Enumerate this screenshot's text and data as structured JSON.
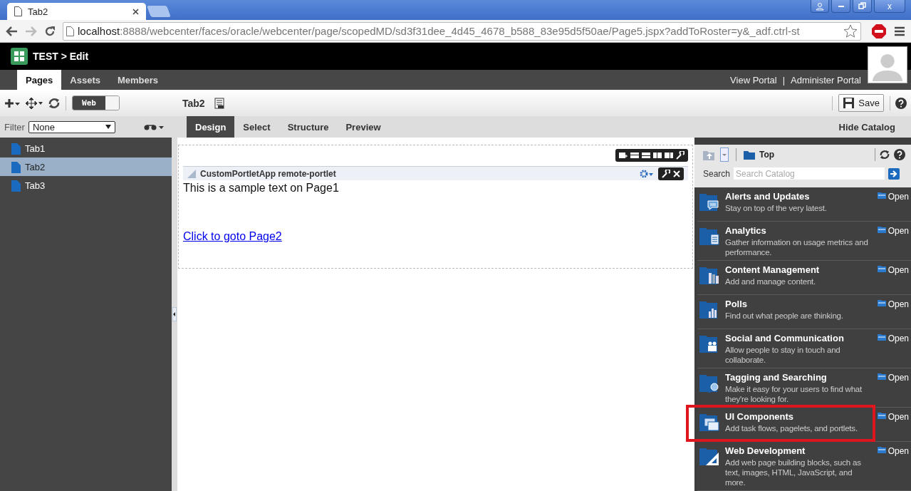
{
  "browser": {
    "tabs": [
      {
        "title": "Tab2",
        "selected": true
      },
      {
        "selected": false
      }
    ],
    "address": {
      "host": "localhost",
      "rest": ":8888/webcenter/faces/oracle/webcenter/page/scopedMD/sd3f31dee_4d45_4678_b588_83e95d5f50ae/Page5.jspx?addToRoster=y&_adf.ctrl-st"
    },
    "window_controls": [
      "x"
    ]
  },
  "header": {
    "title": "TEST > Edit"
  },
  "nav": {
    "tabs": [
      {
        "label": "Pages",
        "selected": true
      },
      {
        "label": "Assets",
        "selected": false
      },
      {
        "label": "Members",
        "selected": false
      }
    ],
    "links": [
      "View Portal",
      "|",
      "Administer Portal"
    ]
  },
  "toolbar": {
    "toggle": {
      "label": "Web",
      "on": true
    },
    "page_title": "Tab2",
    "save": "Save"
  },
  "filter": {
    "label": "Filter",
    "value": "None"
  },
  "mode_tabs": [
    {
      "label": "Design",
      "selected": true
    },
    {
      "label": "Select",
      "selected": false
    },
    {
      "label": "Structure",
      "selected": false
    },
    {
      "label": "Preview",
      "selected": false
    }
  ],
  "hide_catalog": "Hide Catalog",
  "sidebar": {
    "items": [
      {
        "label": "Tab1",
        "selected": false
      },
      {
        "label": "Tab2",
        "selected": true
      },
      {
        "label": "Tab3",
        "selected": false
      }
    ]
  },
  "portlet": {
    "title": "CustomPortletApp remote-portlet",
    "text": "This is a sample text on Page1",
    "link": "Click to goto Page2"
  },
  "catalog": {
    "folder": "Top",
    "search": {
      "label": "Search",
      "placeholder": "Search Catalog"
    },
    "items": [
      {
        "kind": "chat",
        "title": "Alerts and Updates",
        "description": "Stay on top of the very latest.",
        "action": "Open",
        "highlighted": false
      },
      {
        "kind": "chart",
        "title": "Analytics",
        "description": "Gather information on usage metrics and performance.",
        "action": "Open",
        "highlighted": false
      },
      {
        "kind": "docs",
        "title": "Content Management",
        "description": "Add and manage content.",
        "action": "Open",
        "highlighted": false
      },
      {
        "kind": "poll",
        "title": "Polls",
        "description": "Find out what people are thinking.",
        "action": "Open",
        "highlighted": false
      },
      {
        "kind": "people",
        "title": "Social and Communication",
        "description": "Allow people to stay in touch and collaborate.",
        "action": "Open",
        "highlighted": false
      },
      {
        "kind": "search",
        "title": "Tagging and Searching",
        "description": "Make it easy for your users to find what they're looking for.",
        "action": "Open",
        "highlighted": false
      },
      {
        "kind": "windows",
        "title": "UI Components",
        "description": "Add task flows, pagelets, and portlets.",
        "action": "Open",
        "highlighted": true
      },
      {
        "kind": "ruler",
        "title": "Web Development",
        "description": "Add web page building blocks, such as text, images, HTML, JavaScript, and more.",
        "action": "Open",
        "highlighted": false
      }
    ]
  }
}
